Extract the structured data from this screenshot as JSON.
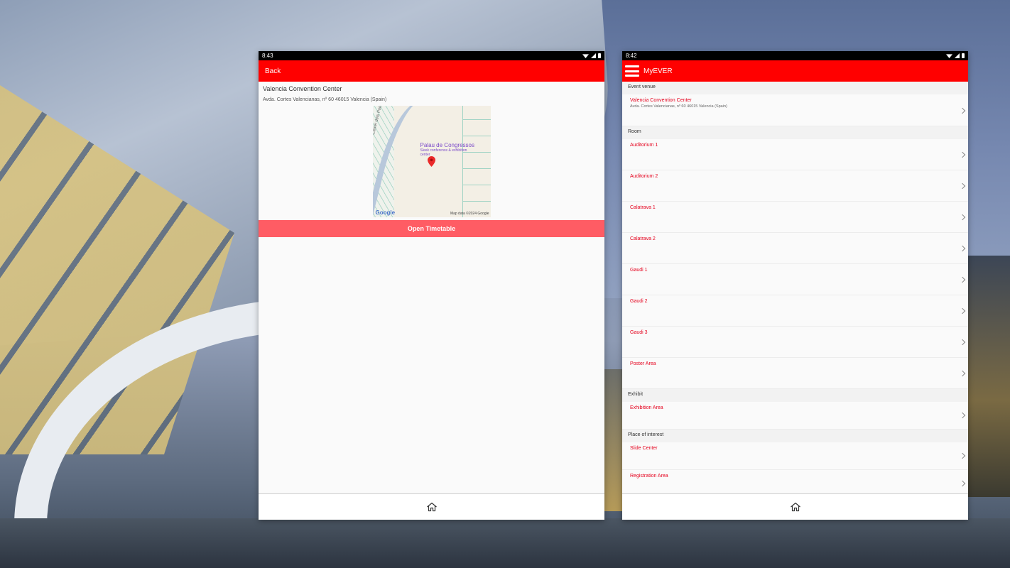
{
  "left_phone": {
    "status_time": "8:43",
    "back_label": "Back",
    "venue_name": "Valencia Convention Center",
    "venue_address": "Avda. Cortes Valencianas, nº 60 46015 Valencia (Spain)",
    "map": {
      "poi_title": "Palau de Congressos",
      "poi_subtitle": "Sleek conference & exhibition center",
      "street_label": "Carrer dels Ports",
      "logo": "Google",
      "attribution": "Map data ©2024 Google"
    },
    "timetable_button": "Open Timetable"
  },
  "right_phone": {
    "status_time": "8:42",
    "app_title": "MyEVER",
    "sections": [
      {
        "header": "Event venue",
        "items": [
          {
            "title": "Valencia Convention Center",
            "subtitle": "Avda. Cortes Valencianas, nº 60 46015 Valencia (Spain)"
          }
        ]
      },
      {
        "header": "Room",
        "items": [
          {
            "title": "Auditorium 1"
          },
          {
            "title": "Auditorium 2"
          },
          {
            "title": "Calatrava 1"
          },
          {
            "title": "Calatrava 2"
          },
          {
            "title": "Gaudi 1"
          },
          {
            "title": "Gaudi 2"
          },
          {
            "title": "Gaudi 3"
          },
          {
            "title": "Poster Area"
          }
        ]
      },
      {
        "header": "Exhibit",
        "items": [
          {
            "title": "Exhibition Area"
          }
        ]
      },
      {
        "header": "Place of interest",
        "items": [
          {
            "title": "Slide Center"
          },
          {
            "title": "Registration Area"
          }
        ]
      }
    ]
  },
  "colors": {
    "app_red": "#ff0000",
    "item_red": "#e5001c",
    "button_pink": "#ff5c64"
  },
  "icons": {
    "bottom_nav": "home-icon",
    "menu": "hamburger-menu-icon",
    "row": "chevron-right-icon"
  }
}
